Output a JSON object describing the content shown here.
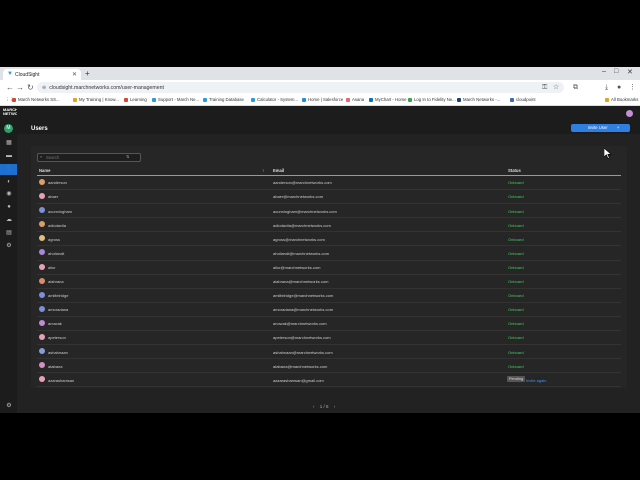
{
  "browser": {
    "tab_title": "CloudSight",
    "url": "cloudsight.marchnetworks.com/user-management",
    "bookmarks": [
      {
        "label": "March Networks SS...",
        "color": "#d9442c"
      },
      {
        "label": "My Training | Know...",
        "color": "#e3a21a"
      },
      {
        "label": "Learning",
        "color": "#d9442c"
      },
      {
        "label": "Support - March Ne...",
        "color": "#2a9bd8"
      },
      {
        "label": "Training Database",
        "color": "#2a9bd8"
      },
      {
        "label": "Calculator - System...",
        "color": "#2a9bd8"
      },
      {
        "label": "Home | Salesforce",
        "color": "#1f8ee0"
      },
      {
        "label": "Asana",
        "color": "#e8627a"
      },
      {
        "label": "MyChart - Home",
        "color": "#0d6fb8"
      },
      {
        "label": "Log In to Fidelity Ne...",
        "color": "#3aa34a"
      },
      {
        "label": "March Networks -...",
        "color": "#1e3f73"
      },
      {
        "label": "cloudpoint",
        "color": "#3a66c4"
      }
    ],
    "all_bookmarks": "All Bookmarks"
  },
  "app": {
    "logo": "MARCH NETWORKS",
    "page_title": "Users",
    "invite_label": "Invite User",
    "user_initial": "M",
    "search_placeholder": "Search",
    "columns": {
      "name": "Name",
      "email": "Email",
      "status": "Status"
    },
    "users": [
      {
        "name": "aanderson",
        "email": "aanderson@marchnetworks.com",
        "status": "Onboard",
        "color": "#d9a06a"
      },
      {
        "name": "abaer",
        "email": "abaer@marchnetworks.com",
        "status": "Onboard",
        "color": "#e8a0b8"
      },
      {
        "name": "acunningham",
        "email": "acunningham@marchnetworks.com",
        "status": "Onboard",
        "color": "#7d8fd6"
      },
      {
        "name": "adiodavila",
        "email": "adiodavila@marchnetworks.com",
        "status": "Onboard",
        "color": "#d9a06a"
      },
      {
        "name": "agross",
        "email": "agross@marchnetworks.com",
        "status": "Onboard",
        "color": "#e0c07a"
      },
      {
        "name": "ahollandt",
        "email": "ahollandt@marchnetworks.com",
        "status": "Onboard",
        "color": "#a48ad6"
      },
      {
        "name": "ailor",
        "email": "ailor@marchnetworks.com",
        "status": "Onboard",
        "color": "#e8a0b8"
      },
      {
        "name": "alabrana",
        "email": "alabrana@marchnetworks.com",
        "status": "Onboard",
        "color": "#d48f6a"
      },
      {
        "name": "amiltelridge",
        "email": "amiltelridge@marchnetworks.com",
        "status": "Onboard",
        "color": "#7d8fd6"
      },
      {
        "name": "amoradana",
        "email": "amoradana@marchnetworks.com",
        "status": "Onboard",
        "color": "#7d8fd6"
      },
      {
        "name": "anowak",
        "email": "anowak@marchnetworks.com",
        "status": "Onboard",
        "color": "#c08ad6"
      },
      {
        "name": "apeterson",
        "email": "apeterson@marchnetworks.com",
        "status": "Onboard",
        "color": "#e8a0b8"
      },
      {
        "name": "ashahnaan",
        "email": "ashahnaan@marchnetworks.com",
        "status": "Onboard",
        "color": "#8a9ad6"
      },
      {
        "name": "atabana",
        "email": "atabana@marchnetworks.com",
        "status": "Onboard",
        "color": "#d48fc0"
      },
      {
        "name": "azarashamsan",
        "email": "aazarashamsan@gmail.com",
        "status": "Pending",
        "color": "#e8a0b8",
        "resend": "Invite again"
      }
    ],
    "pagination": "1 / 8"
  }
}
